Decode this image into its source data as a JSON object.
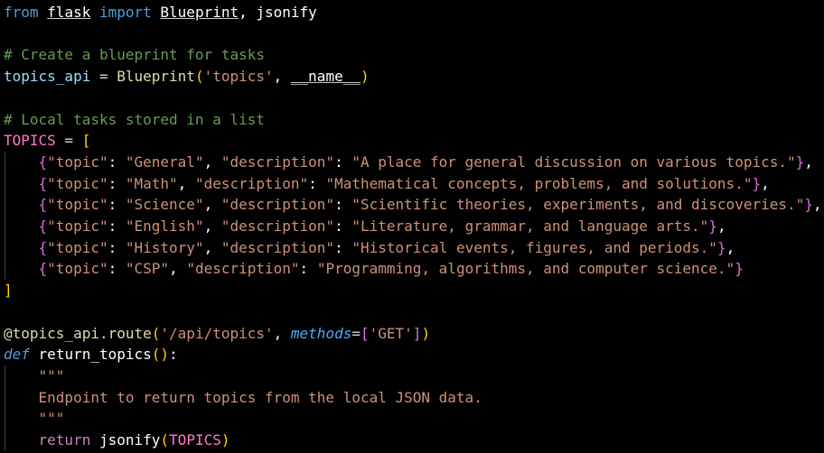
{
  "editor": {
    "language": "python",
    "theme_colors": {
      "background": "#000000",
      "keyword": "#569cd6",
      "control_flow": "#c586c0",
      "string": "#ce9178",
      "comment": "#6a9955",
      "function": "#dcdcaa",
      "variable": "#9cdcfe",
      "constant": "#ff79c6",
      "bracket_gold": "#ffd700",
      "bracket_orchid": "#da70d6",
      "bracket_blue": "#179fff"
    },
    "lines": [
      [
        {
          "t": "from",
          "c": "tok-kw"
        },
        {
          "t": " ",
          "c": "tok-plain"
        },
        {
          "t": "flask",
          "c": "tok-mod"
        },
        {
          "t": " import ",
          "c": "tok-kw"
        },
        {
          "t": "Blueprint",
          "c": "tok-cls"
        },
        {
          "t": ", jsonify",
          "c": "tok-plain"
        }
      ],
      [],
      [
        {
          "t": "# Create a blueprint for tasks",
          "c": "tok-comment"
        }
      ],
      [
        {
          "t": "topics_api",
          "c": "tok-var"
        },
        {
          "t": " = ",
          "c": "tok-op"
        },
        {
          "t": "Blueprint",
          "c": "tok-cls-y"
        },
        {
          "t": "(",
          "c": "tok-b1"
        },
        {
          "t": "'topics'",
          "c": "tok-str"
        },
        {
          "t": ", ",
          "c": "tok-plain"
        },
        {
          "t": "__name__",
          "c": "tok-dunder"
        },
        {
          "t": ")",
          "c": "tok-b1"
        }
      ],
      [],
      [
        {
          "t": "# Local tasks stored in a list",
          "c": "tok-comment"
        }
      ],
      [
        {
          "t": "TOPICS",
          "c": "tok-const"
        },
        {
          "t": " = ",
          "c": "tok-op"
        },
        {
          "t": "[",
          "c": "tok-b1"
        }
      ],
      [
        {
          "t": "    ",
          "c": "tok-plain"
        },
        {
          "t": "{",
          "c": "tok-b2"
        },
        {
          "t": "\"topic\"",
          "c": "tok-str"
        },
        {
          "t": ": ",
          "c": "tok-plain"
        },
        {
          "t": "\"General\"",
          "c": "tok-str"
        },
        {
          "t": ", ",
          "c": "tok-plain"
        },
        {
          "t": "\"description\"",
          "c": "tok-str"
        },
        {
          "t": ": ",
          "c": "tok-plain"
        },
        {
          "t": "\"A place for general discussion on various topics.\"",
          "c": "tok-str"
        },
        {
          "t": "}",
          "c": "tok-b2"
        },
        {
          "t": ",",
          "c": "tok-plain"
        }
      ],
      [
        {
          "t": "    ",
          "c": "tok-plain"
        },
        {
          "t": "{",
          "c": "tok-b2"
        },
        {
          "t": "\"topic\"",
          "c": "tok-str"
        },
        {
          "t": ": ",
          "c": "tok-plain"
        },
        {
          "t": "\"Math\"",
          "c": "tok-str"
        },
        {
          "t": ", ",
          "c": "tok-plain"
        },
        {
          "t": "\"description\"",
          "c": "tok-str"
        },
        {
          "t": ": ",
          "c": "tok-plain"
        },
        {
          "t": "\"Mathematical concepts, problems, and solutions.\"",
          "c": "tok-str"
        },
        {
          "t": "}",
          "c": "tok-b2"
        },
        {
          "t": ",",
          "c": "tok-plain"
        }
      ],
      [
        {
          "t": "    ",
          "c": "tok-plain"
        },
        {
          "t": "{",
          "c": "tok-b2"
        },
        {
          "t": "\"topic\"",
          "c": "tok-str"
        },
        {
          "t": ": ",
          "c": "tok-plain"
        },
        {
          "t": "\"Science\"",
          "c": "tok-str"
        },
        {
          "t": ", ",
          "c": "tok-plain"
        },
        {
          "t": "\"description\"",
          "c": "tok-str"
        },
        {
          "t": ": ",
          "c": "tok-plain"
        },
        {
          "t": "\"Scientific theories, experiments, and discoveries.\"",
          "c": "tok-str"
        },
        {
          "t": "}",
          "c": "tok-b2"
        },
        {
          "t": ",",
          "c": "tok-plain"
        }
      ],
      [
        {
          "t": "    ",
          "c": "tok-plain"
        },
        {
          "t": "{",
          "c": "tok-b2"
        },
        {
          "t": "\"topic\"",
          "c": "tok-str"
        },
        {
          "t": ": ",
          "c": "tok-plain"
        },
        {
          "t": "\"English\"",
          "c": "tok-str"
        },
        {
          "t": ", ",
          "c": "tok-plain"
        },
        {
          "t": "\"description\"",
          "c": "tok-str"
        },
        {
          "t": ": ",
          "c": "tok-plain"
        },
        {
          "t": "\"Literature, grammar, and language arts.\"",
          "c": "tok-str"
        },
        {
          "t": "}",
          "c": "tok-b2"
        },
        {
          "t": ",",
          "c": "tok-plain"
        }
      ],
      [
        {
          "t": "    ",
          "c": "tok-plain"
        },
        {
          "t": "{",
          "c": "tok-b2"
        },
        {
          "t": "\"topic\"",
          "c": "tok-str"
        },
        {
          "t": ": ",
          "c": "tok-plain"
        },
        {
          "t": "\"History\"",
          "c": "tok-str"
        },
        {
          "t": ", ",
          "c": "tok-plain"
        },
        {
          "t": "\"description\"",
          "c": "tok-str"
        },
        {
          "t": ": ",
          "c": "tok-plain"
        },
        {
          "t": "\"Historical events, figures, and periods.\"",
          "c": "tok-str"
        },
        {
          "t": "}",
          "c": "tok-b2"
        },
        {
          "t": ",",
          "c": "tok-plain"
        }
      ],
      [
        {
          "t": "    ",
          "c": "tok-plain"
        },
        {
          "t": "{",
          "c": "tok-b2"
        },
        {
          "t": "\"topic\"",
          "c": "tok-str"
        },
        {
          "t": ": ",
          "c": "tok-plain"
        },
        {
          "t": "\"CSP\"",
          "c": "tok-str"
        },
        {
          "t": ", ",
          "c": "tok-plain"
        },
        {
          "t": "\"description\"",
          "c": "tok-str"
        },
        {
          "t": ": ",
          "c": "tok-plain"
        },
        {
          "t": "\"Programming, algorithms, and computer science.\"",
          "c": "tok-str"
        },
        {
          "t": "}",
          "c": "tok-b2"
        }
      ],
      [
        {
          "t": "]",
          "c": "tok-b1"
        }
      ],
      [],
      [
        {
          "t": "@topics_api.route",
          "c": "tok-fn"
        },
        {
          "t": "(",
          "c": "tok-b1"
        },
        {
          "t": "'/api/topics'",
          "c": "tok-str"
        },
        {
          "t": ", ",
          "c": "tok-plain"
        },
        {
          "t": "methods",
          "c": "tok-param"
        },
        {
          "t": "=",
          "c": "tok-op"
        },
        {
          "t": "[",
          "c": "tok-b2"
        },
        {
          "t": "'GET'",
          "c": "tok-str"
        },
        {
          "t": "]",
          "c": "tok-b2"
        },
        {
          "t": ")",
          "c": "tok-b1"
        }
      ],
      [
        {
          "t": "def",
          "c": "tok-def"
        },
        {
          "t": " ",
          "c": "tok-plain"
        },
        {
          "t": "return_topics",
          "c": "tok-white"
        },
        {
          "t": "()",
          "c": "tok-b1"
        },
        {
          "t": ":",
          "c": "tok-plain"
        }
      ],
      [
        {
          "t": "    ",
          "c": "tok-plain"
        },
        {
          "t": "\"\"\"",
          "c": "tok-doc"
        }
      ],
      [
        {
          "t": "    ",
          "c": "tok-plain"
        },
        {
          "t": "Endpoint to return topics from the local JSON data.",
          "c": "tok-doc"
        }
      ],
      [
        {
          "t": "    ",
          "c": "tok-plain"
        },
        {
          "t": "\"\"\"",
          "c": "tok-doc"
        }
      ],
      [
        {
          "t": "    ",
          "c": "tok-plain"
        },
        {
          "t": "return",
          "c": "tok-flow"
        },
        {
          "t": " ",
          "c": "tok-plain"
        },
        {
          "t": "jsonify",
          "c": "tok-white"
        },
        {
          "t": "(",
          "c": "tok-b1"
        },
        {
          "t": "TOPICS",
          "c": "tok-const"
        },
        {
          "t": ")",
          "c": "tok-b1"
        }
      ]
    ]
  }
}
